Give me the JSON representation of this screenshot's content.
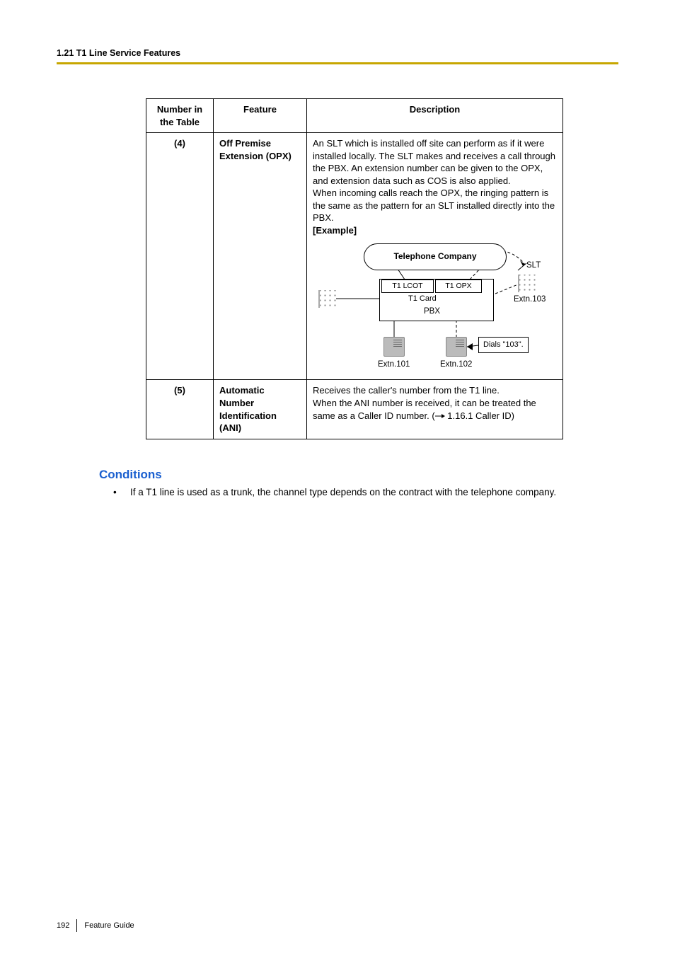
{
  "header": {
    "section": "1.21 T1 Line Service Features"
  },
  "table": {
    "headers": {
      "num": "Number in the Table",
      "feature": "Feature",
      "description": "Description"
    },
    "rows": [
      {
        "num": "(4)",
        "feature": "Off Premise Extension (OPX)",
        "desc_p1": "An SLT which is installed off site can perform as if it were installed locally. The SLT makes and receives a call through the PBX. An extension number can be given to the OPX, and extension data such as COS is also applied.",
        "desc_p2": "When incoming calls reach the OPX, the ringing pattern is the same as the pattern for an SLT installed directly into the PBX.",
        "example_label": "[Example]",
        "diagram": {
          "telco": "Telephone Company",
          "t1_lcot": "T1 LCOT",
          "t1_opx": "T1 OPX",
          "t1_card": "T1  Card",
          "pbx": "PBX",
          "slt": "SLT",
          "extn103": "Extn.103",
          "extn101": "Extn.101",
          "extn102": "Extn.102",
          "dials": "Dials \"103\"."
        }
      },
      {
        "num": "(5)",
        "feature": "Automatic Number Identification (ANI)",
        "desc_p1": "Receives the caller's number from the T1 line.",
        "desc_p2_pre": "When the ANI number is received, it can be treated the same as a Caller ID number. (",
        "desc_p2_link": " 1.16.1 Caller ID",
        "desc_p2_post": ")"
      }
    ]
  },
  "conditions": {
    "heading": "Conditions",
    "items": [
      "If a T1 line is used as a trunk, the channel type depends on the contract with the telephone company."
    ]
  },
  "footer": {
    "page": "192",
    "doc": "Feature Guide"
  }
}
